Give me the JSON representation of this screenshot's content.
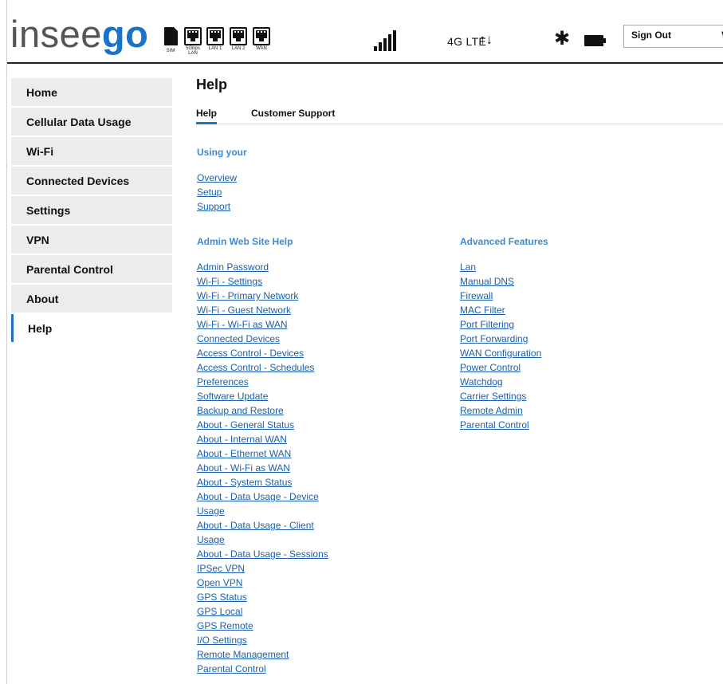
{
  "header": {
    "logo_prefix": "insee",
    "logo_accent": "go",
    "sim_label": "SIM",
    "ports": [
      {
        "label": "5Gbps\nLAN"
      },
      {
        "label": "LAN 1"
      },
      {
        "label": "LAN 2"
      },
      {
        "label": "WAN"
      }
    ],
    "network": "4G LTE",
    "transfer_arrows": "↑↓",
    "bluetooth": "✱",
    "signout": "Sign Out",
    "signout_chevron": "∨"
  },
  "sidebar": {
    "items": [
      {
        "label": "Home"
      },
      {
        "label": "Cellular Data Usage"
      },
      {
        "label": "Wi-Fi"
      },
      {
        "label": "Connected Devices"
      },
      {
        "label": "Settings"
      },
      {
        "label": "VPN"
      },
      {
        "label": "Parental Control"
      },
      {
        "label": "About"
      },
      {
        "label": "Help"
      }
    ],
    "active": "Help"
  },
  "main": {
    "title": "Help",
    "tabs": [
      {
        "label": "Help"
      },
      {
        "label": "Customer Support"
      }
    ],
    "using": {
      "title": "Using your",
      "links": [
        "Overview",
        "Setup",
        "Support"
      ]
    },
    "admin": {
      "title": "Admin Web Site Help",
      "links": [
        "Admin Password",
        "Wi-Fi - Settings",
        "Wi-Fi - Primary Network",
        "Wi-Fi - Guest Network",
        "Wi-Fi - Wi-Fi as WAN",
        "Connected Devices",
        "Access Control - Devices",
        "Access Control - Schedules",
        "Preferences",
        "Software Update",
        "Backup and Restore",
        "About - General Status",
        "About - Internal WAN",
        "About - Ethernet WAN",
        "About - Wi-Fi as WAN",
        "About - System Status",
        "About - Data Usage - Device Usage",
        "About - Data Usage - Client Usage",
        "About - Data Usage - Sessions",
        "IPSec VPN",
        "Open VPN",
        "GPS Status",
        "GPS Local",
        "GPS Remote",
        "I/O Settings",
        "Remote Management",
        "Parental Control"
      ]
    },
    "advanced": {
      "title": "Advanced Features",
      "links": [
        "Lan",
        "Manual DNS",
        "Firewall",
        "MAC Filter",
        "Port Filtering",
        "Port Forwarding",
        "WAN Configuration",
        "Power Control",
        "Watchdog",
        "Carrier Settings",
        "Remote Admin",
        "Parental Control"
      ]
    }
  }
}
